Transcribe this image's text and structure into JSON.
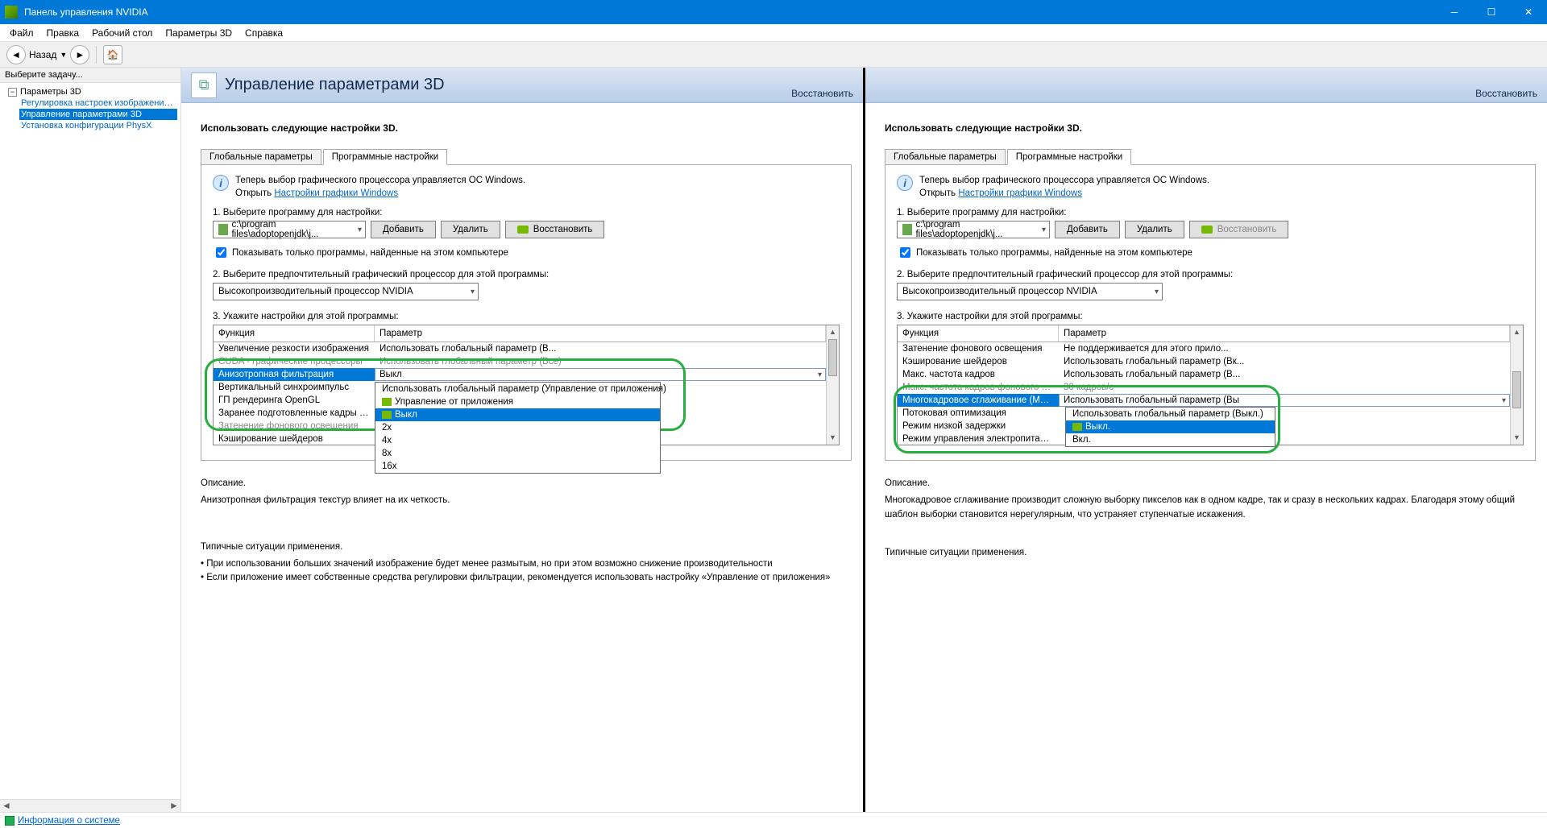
{
  "titlebar": {
    "title": "Панель управления NVIDIA"
  },
  "menubar": [
    "Файл",
    "Правка",
    "Рабочий стол",
    "Параметры 3D",
    "Справка"
  ],
  "toolbar": {
    "back": "Назад"
  },
  "sidebar": {
    "title": "Выберите задачу...",
    "root": "Параметры 3D",
    "items": [
      "Регулировка настроек изображения с п",
      "Управление параметрами 3D",
      "Установка конфигурации PhysX"
    ],
    "selected": 1
  },
  "page": {
    "title": "Управление параметрами 3D",
    "restore": "Восстановить",
    "intro": "Использовать следующие настройки 3D.",
    "tabs": [
      "Глобальные параметры",
      "Программные настройки"
    ],
    "activeTab": 1,
    "info1": "Теперь выбор графического процессора управляется ОС Windows.",
    "info2a": "Открыть ",
    "info2b": "Настройки графики Windows",
    "step1": "1. Выберите программу для настройки:",
    "program": "c:\\program files\\adoptopenjdk\\j...",
    "addBtn": "Добавить",
    "removeBtn": "Удалить",
    "restoreBtn": "Восстановить",
    "showOnly": "Показывать только программы, найденные на этом компьютере",
    "step2": "2. Выберите предпочтительный графический процессор для этой программы:",
    "gpu": "Высокопроизводительный процессор NVIDIA",
    "step3": "3. Укажите настройки для этой программы:",
    "th_func": "Функция",
    "th_param": "Параметр"
  },
  "leftTable": {
    "rows": [
      {
        "f": "Увеличение резкости изображения",
        "p": "Использовать глобальный параметр (В..."
      },
      {
        "f": "CUDA - графические процессоры",
        "p": "Использовать глобальный параметр (Все)",
        "dim": true
      },
      {
        "f": "Анизотропная фильтрация",
        "p": "Выкл",
        "sel": true
      },
      {
        "f": "Вертикальный синхроимпульс",
        "p": ""
      },
      {
        "f": "ГП рендеринга OpenGL",
        "p": ""
      },
      {
        "f": "Заранее подготовленные кадры вирту...",
        "p": ""
      },
      {
        "f": "Затенение фонового освещения",
        "p": "",
        "dim": true
      },
      {
        "f": "Кэширование шейдеров",
        "p": ""
      }
    ],
    "dropdown": [
      "Использовать глобальный параметр (Управление от приложения)",
      "Управление от приложения",
      "Выкл",
      "2x",
      "4x",
      "8x",
      "16x"
    ],
    "ddSel": 2
  },
  "rightTable": {
    "rows": [
      {
        "f": "Затенение фонового освещения",
        "p": "Не поддерживается для этого прило..."
      },
      {
        "f": "Кэширование шейдеров",
        "p": "Использовать глобальный параметр (Вк..."
      },
      {
        "f": "Макс. частота кадров",
        "p": "Использовать глобальный параметр (В..."
      },
      {
        "f": "Макс. частота кадров фонового прило...",
        "p": "30 кадров/с",
        "dim": true
      },
      {
        "f": "Многокадровое сглаживание (MFAA)",
        "p": "Использовать глобальный параметр (Вы",
        "sel": true
      },
      {
        "f": "Потоковая оптимизация",
        "p": ""
      },
      {
        "f": "Режим низкой задержки",
        "p": ""
      },
      {
        "f": "Режим управления электропитанием",
        "p": ""
      }
    ],
    "dropdown": [
      "Использовать глобальный параметр (Выкл.)",
      "Выкл.",
      "Вкл."
    ],
    "ddSel": 1
  },
  "leftDesc": {
    "h": "Описание.",
    "t": "Анизотропная фильтрация текстур влияет на их четкость.",
    "h2": "Типичные ситуации применения.",
    "b": [
      "• При использовании больших значений изображение будет менее размытым, но при этом возможно снижение производительности",
      "• Если приложение имеет собственные средства регулировки фильтрации, рекомендуется использовать настройку «Управление от приложения»"
    ]
  },
  "rightDesc": {
    "h": "Описание.",
    "t": "Многокадровое сглаживание производит сложную выборку пикселов как в одном кадре, так и сразу в нескольких кадрах. Благодаря этому общий шаблон выборки становится нерегулярным, что устраняет ступенчатые искажения.",
    "h2": "Типичные ситуации применения."
  },
  "status": {
    "link": "Информация о системе"
  }
}
